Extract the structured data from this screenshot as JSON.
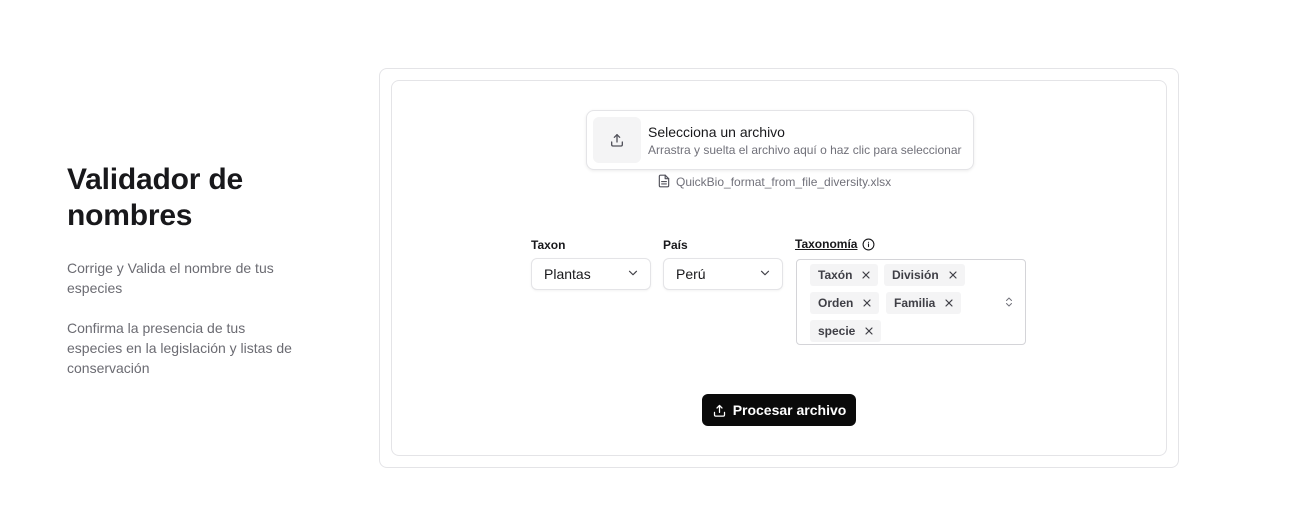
{
  "intro": {
    "title": "Validador de nombres",
    "description_1": "Corrige y Valida el nombre de tus especies",
    "description_2": "Confirma la presencia de tus especies en la legislación y listas de conservación"
  },
  "upload": {
    "title": "Selecciona un archivo",
    "subtitle": "Arrastra y suelta el archivo aquí o haz clic para seleccionar",
    "icon": "upload-icon"
  },
  "selected_file": {
    "name": "QuickBio_format_from_file_diversity.xlsx",
    "icon": "file-icon"
  },
  "fields": {
    "taxon": {
      "label": "Taxon",
      "value": "Plantas"
    },
    "country": {
      "label": "País",
      "value": "Perú"
    },
    "taxonomy": {
      "label": "Taxonomía",
      "tags": [
        "Taxón",
        "División",
        "Orden",
        "Familia",
        "specie"
      ]
    }
  },
  "actions": {
    "process_label": "Procesar archivo"
  },
  "colors": {
    "primary_button": "#0a0a0a",
    "border": "#e4e4e7",
    "muted_text": "#71717a",
    "tag_bg": "#f4f4f5"
  }
}
